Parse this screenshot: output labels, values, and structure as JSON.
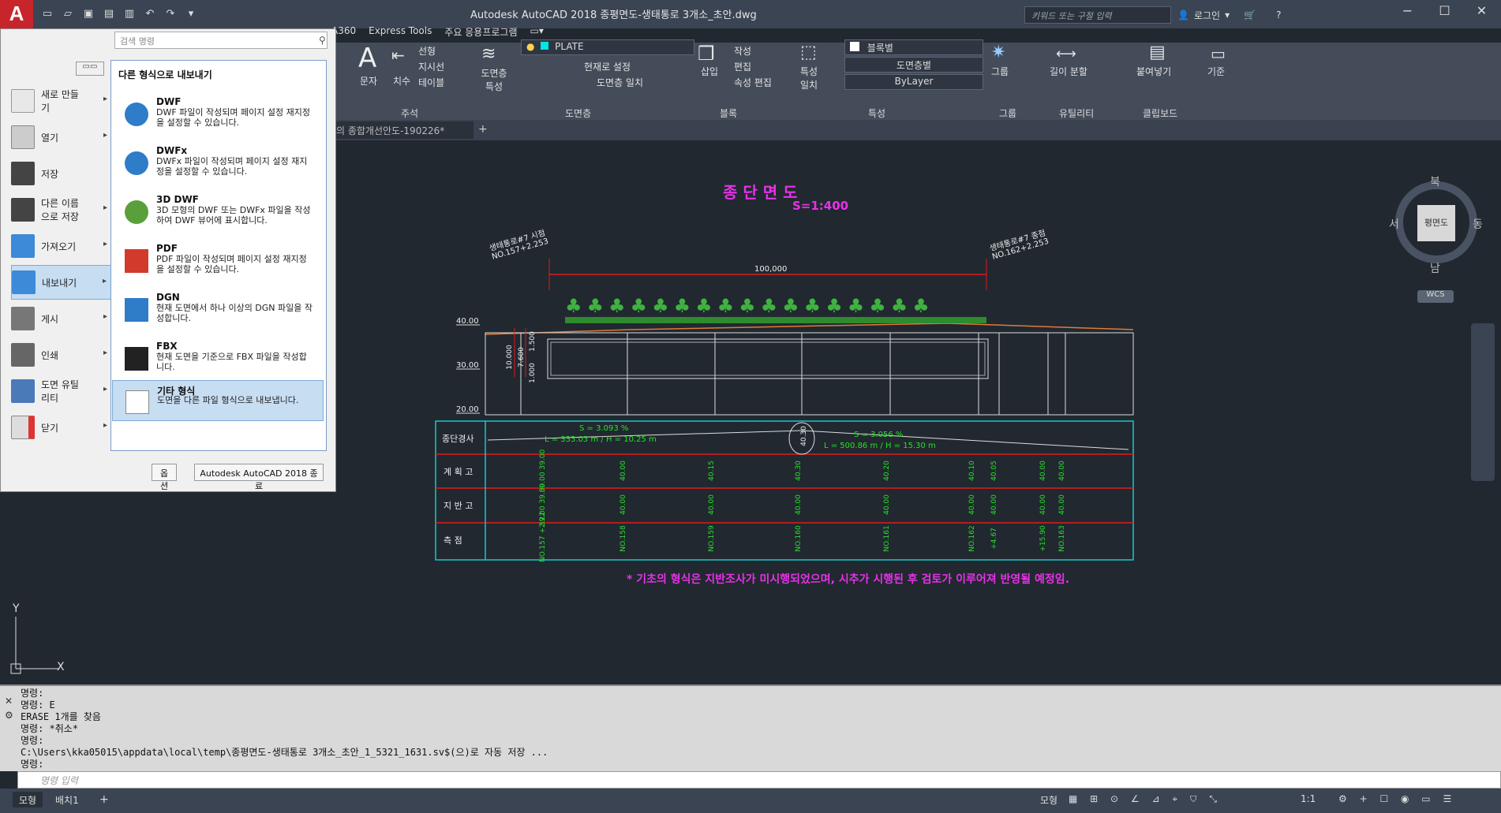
{
  "title": "Autodesk AutoCAD 2018    종평면도-생태통로 3개소_초안.dwg",
  "search_placeholder": "키워드 또는 구절 입력",
  "login": "로그인",
  "ribbon_tabs": [
    "A360",
    "Express Tools",
    "주요 응용프로그램"
  ],
  "ribbon": {
    "annotation": {
      "label": "주석",
      "text": "문자",
      "dim": "치수",
      "linear": "선형",
      "leader": "지시선",
      "table": "테이블"
    },
    "layers": {
      "label": "도면층",
      "props": "도면층 특성",
      "current_layer": "PLATE",
      "make_current": "현재로 설정",
      "match": "도면층 일치"
    },
    "block": {
      "label": "블록",
      "insert": "삽입",
      "create": "작성",
      "edit": "편집",
      "attr_edit": "속성 편집"
    },
    "properties": {
      "label": "특성",
      "match": "특성 일치",
      "color": "블록별",
      "linetype": "도면층별",
      "lineweight": "ByLayer"
    },
    "groups": {
      "label": "그룹",
      "group": "그룹"
    },
    "utilities": {
      "label": "유틸리티",
      "measure": "길이 분할"
    },
    "clipboard": {
      "label": "클립보드",
      "paste": "붙여넣기"
    },
    "view": {
      "base": "기준"
    }
  },
  "doc_tab": "의 종합개선안도-190226*",
  "app_menu": {
    "search_placeholder": "검색 명령",
    "items": [
      {
        "label": "새로 만들기",
        "arrow": "▸"
      },
      {
        "label": "열기",
        "arrow": "▸"
      },
      {
        "label": "저장",
        "arrow": ""
      },
      {
        "label": "다른 이름으로 저장",
        "arrow": "▸"
      },
      {
        "label": "가져오기",
        "arrow": "▸"
      },
      {
        "label": "내보내기",
        "arrow": "▸"
      },
      {
        "label": "게시",
        "arrow": "▸"
      },
      {
        "label": "인쇄",
        "arrow": "▸"
      },
      {
        "label": "도면 유틸리티",
        "arrow": "▸"
      },
      {
        "label": "닫기",
        "arrow": "▸"
      }
    ],
    "submenu_title": "다른 형식으로 내보내기",
    "export_items": [
      {
        "name": "DWF",
        "desc": "DWF 파일이 작성되며 페이지 설정 재지정을 설정할 수 있습니다."
      },
      {
        "name": "DWFx",
        "desc": "DWFx 파일이 작성되며 페이지 설정 재지정을 설정할 수 있습니다."
      },
      {
        "name": "3D DWF",
        "desc": "3D 모형의 DWF 또는 DWFx 파일을 작성하여 DWF 뷰어에 표시합니다."
      },
      {
        "name": "PDF",
        "desc": "PDF 파일이 작성되며 페이지 설정 재지정을 설정할 수 있습니다."
      },
      {
        "name": "DGN",
        "desc": "현재 도면에서 하나 이상의 DGN 파일을 작성합니다."
      },
      {
        "name": "FBX",
        "desc": "현재 도면을 기준으로 FBX 파일을 작성합니다."
      },
      {
        "name": "기타 형식",
        "desc": "도면을 다른 파일 형식으로 내보냅니다."
      }
    ],
    "options_button": "옵션",
    "exit_button": "Autodesk AutoCAD 2018 종료"
  },
  "drawing": {
    "title": "종 단 면 도",
    "scale": "S=1:400",
    "left_station": "생태통로#7 시점",
    "left_station_no": "NO.157+2.253",
    "right_station": "생태통로#7 종점",
    "right_station_no": "NO.162+2.253",
    "dim_length": "100,000",
    "elev_labels": [
      "40.00",
      "30.00",
      "20.00"
    ],
    "vert_dims": [
      "10.000",
      "7.600",
      "1.500",
      "1.000"
    ],
    "rows": [
      "종단경사",
      "계 획 고",
      "지 반 고",
      "측    점"
    ],
    "slope1_s": "S = 3.093 %",
    "slope1_l": "L = 333.03 m / H = 10.25 m",
    "slope2_s": "S = 3.056 %",
    "slope2_l": "L = 500.86 m / H = 15.30 m",
    "pvi": "40.30",
    "plan_heights": [
      "39.00 39.00",
      "40.00",
      "40.15",
      "40.30",
      "40.20",
      "40.10",
      "40.05",
      "40.00",
      "40.00"
    ],
    "ground_heights": [
      "39.00 39.00",
      "40.00",
      "40.00",
      "40.00",
      "40.00",
      "40.00",
      "40.00",
      "40.00",
      "40.00"
    ],
    "stations": [
      "NO.157 +2.22",
      "NO.158",
      "NO.159",
      "NO.160",
      "NO.161",
      "NO.162",
      "+4.67",
      "+15.90",
      "NO.163"
    ],
    "note": "* 기초의 형식은 지반조사가 미시행되었으며, 시추가 시행된 후 검토가 이루어져 반영될 예정임."
  },
  "viewcube": {
    "n": "북",
    "s": "남",
    "e": "동",
    "w": "서",
    "face": "평면도",
    "wcs": "WCS"
  },
  "ucs": {
    "x": "X",
    "y": "Y"
  },
  "command_history": [
    "명령:",
    "명령: E",
    "ERASE 1개를 찾음",
    "명령: *취소*",
    "명령:",
    "C:\\Users\\kka05015\\appdata\\local\\temp\\종평면도-생태통로 3개소_초안_1_5321_1631.sv$(으)로 자동 저장 ...",
    "명령:"
  ],
  "command_placeholder": "명령 입력",
  "layout_tabs": [
    "모형",
    "배치1"
  ],
  "status": {
    "model": "모형",
    "scale": "1:1"
  }
}
